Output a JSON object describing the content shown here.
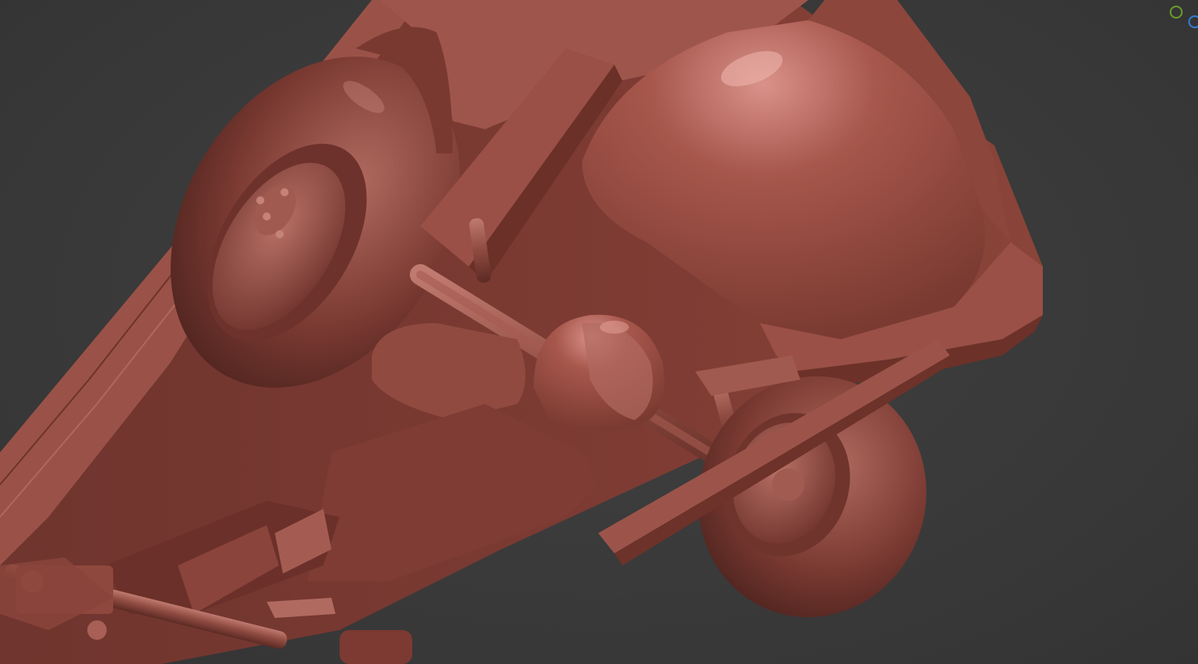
{
  "viewport": {
    "shading": "clay",
    "colors": {
      "background": "#3b3b3b",
      "clay_base": "#8e4b42",
      "clay_light": "#c4776c",
      "clay_dark": "#5a2a24",
      "clay_shadow": "#3d1c18"
    }
  },
  "gizmo": {
    "icon": "navigation-gizmo-icon",
    "colors": {
      "y_axis": "#6a9a2a",
      "z_axis": "#2f7fd1"
    }
  }
}
